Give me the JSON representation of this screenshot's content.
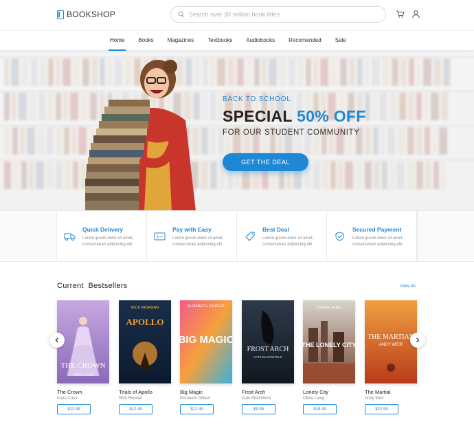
{
  "header": {
    "brand": "BOOKSHOP",
    "search_placeholder": "Search over 30 million book titles"
  },
  "nav": {
    "items": [
      {
        "label": "Home",
        "active": true
      },
      {
        "label": "Books",
        "active": false
      },
      {
        "label": "Magazines",
        "active": false
      },
      {
        "label": "Textbooks",
        "active": false
      },
      {
        "label": "Audiobooks",
        "active": false
      },
      {
        "label": "Recomended",
        "active": false
      },
      {
        "label": "Sale",
        "active": false
      }
    ]
  },
  "hero": {
    "kicker": "BACK TO SCHOOL",
    "title_prefix": "SPECIAL",
    "title_highlight": "50% OFF",
    "subtitle": "FOR OUR STUDENT COMMUNITY",
    "cta": "GET THE DEAL"
  },
  "features": [
    {
      "icon": "truck-icon",
      "title": "Quick Delivery",
      "desc": "Lorem ipsum dolor sit amet, consectetuer adipiscing elit."
    },
    {
      "icon": "money-icon",
      "title": "Pay with Easy",
      "desc": "Lorem ipsum dolor sit amet, consectetuer adipiscing elit."
    },
    {
      "icon": "tag-icon",
      "title": "Best Deal",
      "desc": "Lorem ipsum dolor sit amet, consectetuer adipiscing elit."
    },
    {
      "icon": "shield-check-icon",
      "title": "Secured Payment",
      "desc": "Lorem ipsum dolor sit amet, consectetuer adipiscing elit."
    }
  ],
  "bestsellers": {
    "heading": "Current  Bestsellers",
    "view_all": "View All",
    "books": [
      {
        "title": "The Crown",
        "author": "Kiera Cass",
        "price": "$13.99",
        "cover_text": "THE CROWN",
        "cover_author": "KIERA CASS"
      },
      {
        "title": "Trials of Apollo",
        "author": "Rick Riordan",
        "price": "$12.49",
        "cover_text": "APOLLO",
        "cover_author": "RICK RIORDAN"
      },
      {
        "title": "Big Magic",
        "author": "Elizabeth Gilbert",
        "price": "$12.49",
        "cover_text": "BIG MAGIC",
        "cover_author": "ELIZABETH GILBERT"
      },
      {
        "title": "Frost Arch",
        "author": "Kate Bloomfield",
        "price": "$9.99",
        "cover_text": "FROST ARCH",
        "cover_author": "KATE BLOOMFIELD"
      },
      {
        "title": "Lonely City",
        "author": "Olivia Laing",
        "price": "$18.99",
        "cover_text": "THE LONELY CITY",
        "cover_author": "OLIVIA LAING"
      },
      {
        "title": "The Martial",
        "author": "Andy Weir",
        "price": "$22.99",
        "cover_text": "THE MARTIAN",
        "cover_author": "ANDY WEIR"
      }
    ]
  },
  "colors": {
    "accent": "#1e88d6",
    "text": "#222222",
    "muted": "#888888"
  }
}
